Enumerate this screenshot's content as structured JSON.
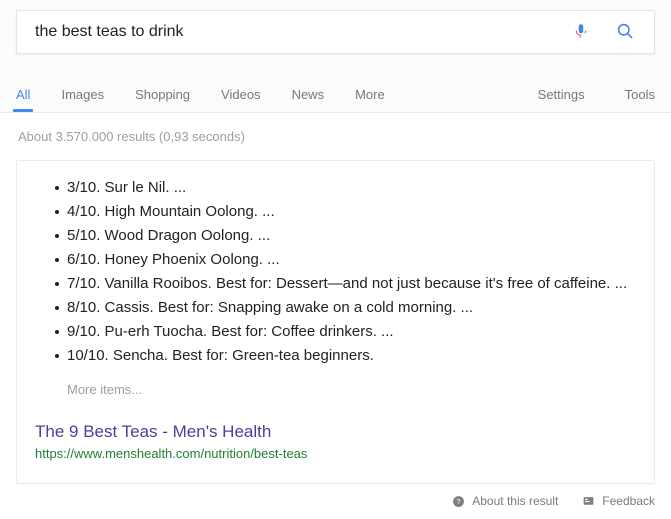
{
  "search": {
    "query": "the best teas to drink",
    "placeholder": "Search",
    "mic_icon": "microphone-icon",
    "search_icon": "search-icon"
  },
  "nav": {
    "tabs": [
      {
        "label": "All",
        "active": true
      },
      {
        "label": "Images",
        "active": false
      },
      {
        "label": "Shopping",
        "active": false
      },
      {
        "label": "Videos",
        "active": false
      },
      {
        "label": "News",
        "active": false
      },
      {
        "label": "More",
        "active": false
      }
    ],
    "right_items": [
      {
        "label": "Settings"
      },
      {
        "label": "Tools"
      }
    ]
  },
  "result_stats": "About 3.570.000 results (0,93 seconds)",
  "featured_snippet": {
    "items": [
      "3/10. Sur le Nil. ...",
      "4/10. High Mountain Oolong. ...",
      "5/10. Wood Dragon Oolong. ...",
      "6/10. Honey Phoenix Oolong. ...",
      "7/10. Vanilla Rooibos. Best for: Dessert—and not just because it's free of caffeine. ...",
      "8/10. Cassis. Best for: Snapping awake on a cold morning. ...",
      "9/10. Pu-erh Tuocha. Best for: Coffee drinkers. ...",
      "10/10. Sencha. Best for: Green-tea beginners."
    ],
    "more_items_label": "More items...",
    "source_title": "The 9 Best Teas - Men's Health",
    "source_url": "https://www.menshealth.com/nutrition/best-teas"
  },
  "footer": {
    "about_label": "About this result",
    "about_icon": "help-circle-icon",
    "feedback_label": "Feedback",
    "feedback_icon": "feedback-flag-icon"
  },
  "colors": {
    "accent_blue": "#4285f4",
    "link_purple": "#4b3f9e",
    "url_green": "#1e7d33",
    "text_dark": "#222222",
    "text_muted": "#9e9e9e",
    "mic_blue": "#4285f4",
    "mic_red": "#ea4335",
    "mic_yellow": "#fbbc05",
    "mic_green": "#34a853"
  }
}
